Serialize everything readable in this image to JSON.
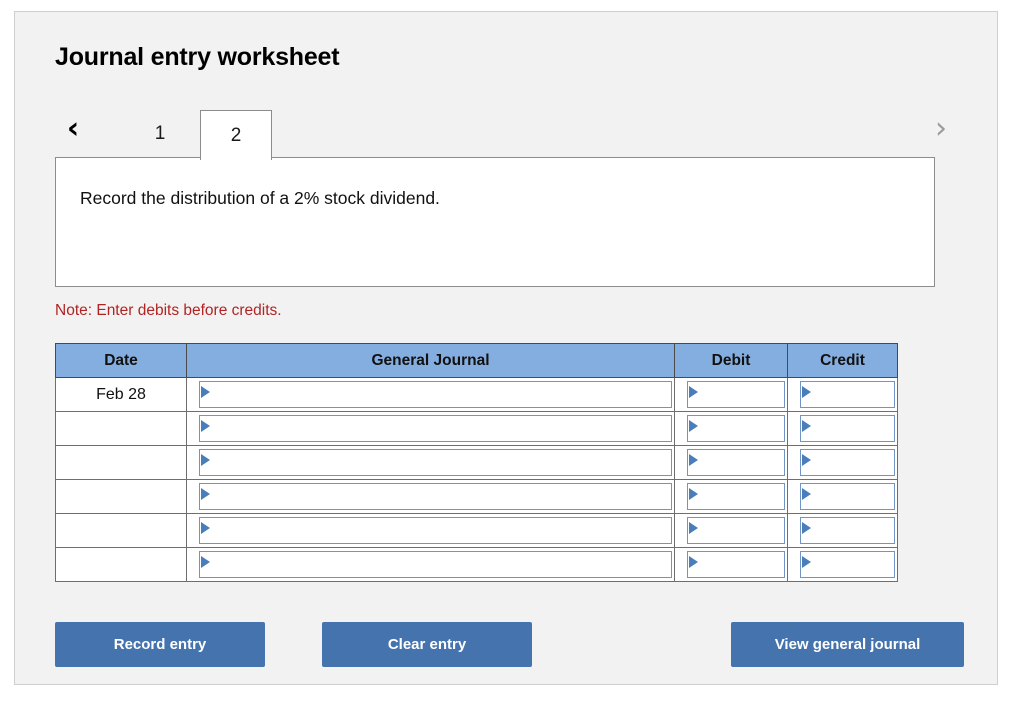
{
  "panel": {
    "title": "Journal entry worksheet"
  },
  "pager": {
    "prev_icon": "chevron-left-icon",
    "next_icon": "chevron-right-icon",
    "prev_glyph": "‹",
    "next_glyph": "›",
    "active_tab": "2",
    "tabs": [
      {
        "label": "1",
        "active": false
      },
      {
        "label": "2",
        "active": true
      }
    ]
  },
  "instruction": {
    "text": "Record the distribution of a 2% stock dividend."
  },
  "note": {
    "text": "Note: Enter debits before credits."
  },
  "journal": {
    "columns": [
      "Date",
      "General Journal",
      "Debit",
      "Credit"
    ],
    "rows": [
      {
        "date": "Feb 28",
        "general_journal": "",
        "debit": "",
        "credit": ""
      },
      {
        "date": "",
        "general_journal": "",
        "debit": "",
        "credit": ""
      },
      {
        "date": "",
        "general_journal": "",
        "debit": "",
        "credit": ""
      },
      {
        "date": "",
        "general_journal": "",
        "debit": "",
        "credit": ""
      },
      {
        "date": "",
        "general_journal": "",
        "debit": "",
        "credit": ""
      },
      {
        "date": "",
        "general_journal": "",
        "debit": "",
        "credit": ""
      }
    ]
  },
  "actions": {
    "record_entry": "Record entry",
    "clear_entry": "Clear entry",
    "view_general_journal": "View general journal"
  },
  "colors": {
    "panel_bg": "#f2f2f2",
    "panel_border": "#cfcfcf",
    "header_blue": "#85aee0",
    "button_blue": "#4473ae",
    "note_red": "#b02424",
    "field_border": "#7094c6",
    "caret_blue": "#4a7ebb",
    "tab_border": "#8c8c8c"
  }
}
